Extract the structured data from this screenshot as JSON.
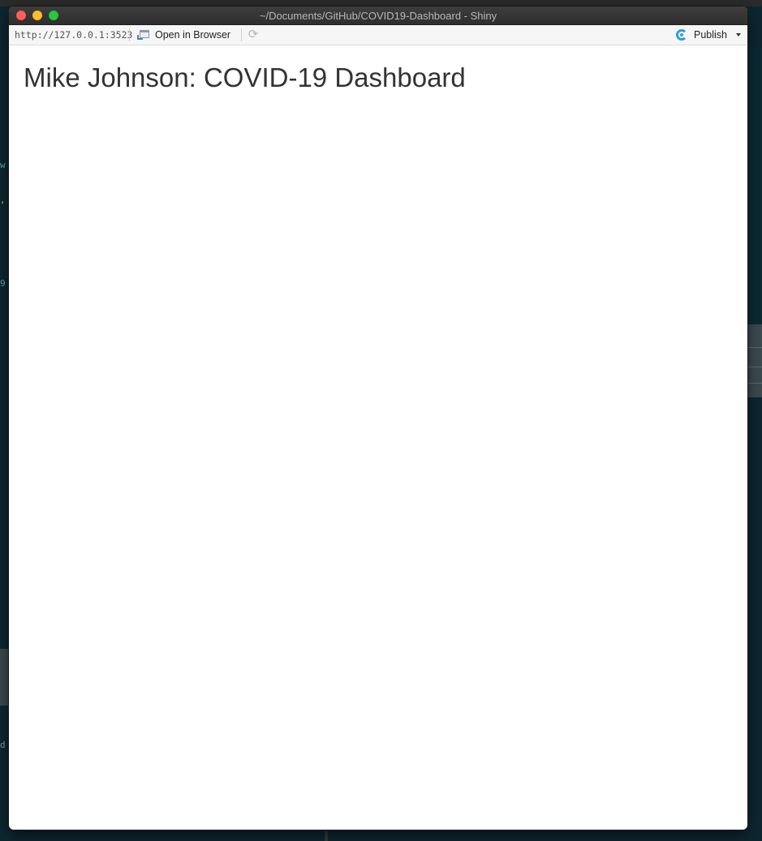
{
  "window": {
    "title": "~/Documents/GitHub/COVID19-Dashboard - Shiny"
  },
  "toolbar": {
    "url": "http://127.0.0.1:3523",
    "open_in_browser_label": "Open in Browser",
    "publish_label": "Publish"
  },
  "app": {
    "title": "Mike Johnson: COVID-19 Dashboard"
  },
  "background_ide": {
    "glyphs": [
      "w",
      ",",
      "9",
      "d"
    ]
  },
  "colors": {
    "publish_accent": "#2d9fdb",
    "ide_background": "#0d2730",
    "titlebar": "#333333"
  }
}
